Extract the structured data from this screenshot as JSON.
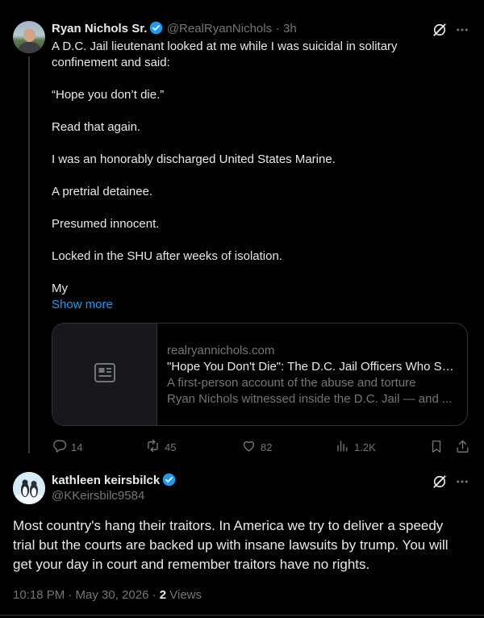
{
  "tweet1": {
    "name": "Ryan Nichols Sr.",
    "handle": "@RealRyanNichols",
    "separator": "·",
    "time": "3h",
    "lines": [
      "A D.C. Jail lieutenant looked at me while I was suicidal in solitary",
      "confinement and said:",
      "“Hope you don’t die.”",
      "Read that again.",
      "I was an honorably discharged United States Marine.",
      "A pretrial detainee.",
      "Presumed innocent.",
      "Locked in the SHU after weeks of isolation.",
      "My"
    ],
    "show_more": "Show more",
    "card": {
      "domain": "realryannichols.com",
      "title": "\"Hope You Don't Die\": The D.C. Jail Officers Who Sh...",
      "desc_line1": "A first-person account of the abuse and torture",
      "desc_line2": "Ryan Nichols witnessed inside the D.C. Jail — and ..."
    },
    "stats": {
      "replies": "14",
      "reposts": "45",
      "likes": "82",
      "views": "1.2K"
    }
  },
  "tweet2": {
    "name": "kathleen keirsbilck",
    "handle": "@KKeirsbilc9584",
    "body_lines": [
      "Most country's hang their traitors. In America we try to deliver a speedy",
      "trial but the courts are backed up with insane lawsuits by trump. You will",
      "get your day in court and remember traitors have no rights."
    ],
    "timestamp": "10:18 PM · May 30, 2026 · ",
    "views_count": "2",
    "views_label": " Views"
  },
  "colors": {
    "background": "#000000",
    "text": "#e7e9ea",
    "muted": "#71767b",
    "accent": "#1d9bf0",
    "border": "#2f3336"
  },
  "icons": [
    "grok-icon",
    "more-icon",
    "verified-icon",
    "article-icon",
    "reply-icon",
    "repost-icon",
    "like-icon",
    "views-icon",
    "bookmark-icon",
    "share-icon"
  ]
}
